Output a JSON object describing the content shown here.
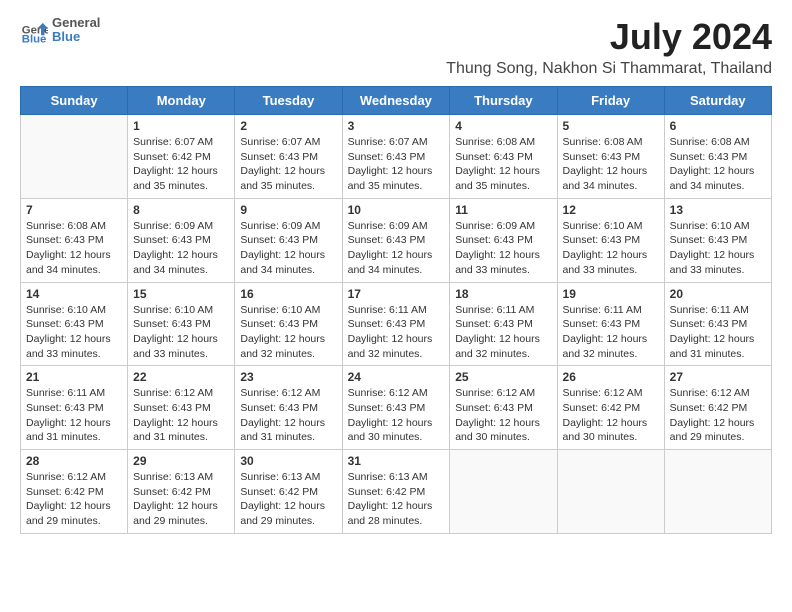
{
  "header": {
    "logo": {
      "line1": "General",
      "line2": "Blue"
    },
    "title": "July 2024",
    "subtitle": "Thung Song, Nakhon Si Thammarat, Thailand"
  },
  "calendar": {
    "weekdays": [
      "Sunday",
      "Monday",
      "Tuesday",
      "Wednesday",
      "Thursday",
      "Friday",
      "Saturday"
    ],
    "weeks": [
      [
        {
          "day": "",
          "sunrise": "",
          "sunset": "",
          "daylight": ""
        },
        {
          "day": "1",
          "sunrise": "Sunrise: 6:07 AM",
          "sunset": "Sunset: 6:42 PM",
          "daylight": "Daylight: 12 hours and 35 minutes."
        },
        {
          "day": "2",
          "sunrise": "Sunrise: 6:07 AM",
          "sunset": "Sunset: 6:43 PM",
          "daylight": "Daylight: 12 hours and 35 minutes."
        },
        {
          "day": "3",
          "sunrise": "Sunrise: 6:07 AM",
          "sunset": "Sunset: 6:43 PM",
          "daylight": "Daylight: 12 hours and 35 minutes."
        },
        {
          "day": "4",
          "sunrise": "Sunrise: 6:08 AM",
          "sunset": "Sunset: 6:43 PM",
          "daylight": "Daylight: 12 hours and 35 minutes."
        },
        {
          "day": "5",
          "sunrise": "Sunrise: 6:08 AM",
          "sunset": "Sunset: 6:43 PM",
          "daylight": "Daylight: 12 hours and 34 minutes."
        },
        {
          "day": "6",
          "sunrise": "Sunrise: 6:08 AM",
          "sunset": "Sunset: 6:43 PM",
          "daylight": "Daylight: 12 hours and 34 minutes."
        }
      ],
      [
        {
          "day": "7",
          "sunrise": "Sunrise: 6:08 AM",
          "sunset": "Sunset: 6:43 PM",
          "daylight": "Daylight: 12 hours and 34 minutes."
        },
        {
          "day": "8",
          "sunrise": "Sunrise: 6:09 AM",
          "sunset": "Sunset: 6:43 PM",
          "daylight": "Daylight: 12 hours and 34 minutes."
        },
        {
          "day": "9",
          "sunrise": "Sunrise: 6:09 AM",
          "sunset": "Sunset: 6:43 PM",
          "daylight": "Daylight: 12 hours and 34 minutes."
        },
        {
          "day": "10",
          "sunrise": "Sunrise: 6:09 AM",
          "sunset": "Sunset: 6:43 PM",
          "daylight": "Daylight: 12 hours and 34 minutes."
        },
        {
          "day": "11",
          "sunrise": "Sunrise: 6:09 AM",
          "sunset": "Sunset: 6:43 PM",
          "daylight": "Daylight: 12 hours and 33 minutes."
        },
        {
          "day": "12",
          "sunrise": "Sunrise: 6:10 AM",
          "sunset": "Sunset: 6:43 PM",
          "daylight": "Daylight: 12 hours and 33 minutes."
        },
        {
          "day": "13",
          "sunrise": "Sunrise: 6:10 AM",
          "sunset": "Sunset: 6:43 PM",
          "daylight": "Daylight: 12 hours and 33 minutes."
        }
      ],
      [
        {
          "day": "14",
          "sunrise": "Sunrise: 6:10 AM",
          "sunset": "Sunset: 6:43 PM",
          "daylight": "Daylight: 12 hours and 33 minutes."
        },
        {
          "day": "15",
          "sunrise": "Sunrise: 6:10 AM",
          "sunset": "Sunset: 6:43 PM",
          "daylight": "Daylight: 12 hours and 33 minutes."
        },
        {
          "day": "16",
          "sunrise": "Sunrise: 6:10 AM",
          "sunset": "Sunset: 6:43 PM",
          "daylight": "Daylight: 12 hours and 32 minutes."
        },
        {
          "day": "17",
          "sunrise": "Sunrise: 6:11 AM",
          "sunset": "Sunset: 6:43 PM",
          "daylight": "Daylight: 12 hours and 32 minutes."
        },
        {
          "day": "18",
          "sunrise": "Sunrise: 6:11 AM",
          "sunset": "Sunset: 6:43 PM",
          "daylight": "Daylight: 12 hours and 32 minutes."
        },
        {
          "day": "19",
          "sunrise": "Sunrise: 6:11 AM",
          "sunset": "Sunset: 6:43 PM",
          "daylight": "Daylight: 12 hours and 32 minutes."
        },
        {
          "day": "20",
          "sunrise": "Sunrise: 6:11 AM",
          "sunset": "Sunset: 6:43 PM",
          "daylight": "Daylight: 12 hours and 31 minutes."
        }
      ],
      [
        {
          "day": "21",
          "sunrise": "Sunrise: 6:11 AM",
          "sunset": "Sunset: 6:43 PM",
          "daylight": "Daylight: 12 hours and 31 minutes."
        },
        {
          "day": "22",
          "sunrise": "Sunrise: 6:12 AM",
          "sunset": "Sunset: 6:43 PM",
          "daylight": "Daylight: 12 hours and 31 minutes."
        },
        {
          "day": "23",
          "sunrise": "Sunrise: 6:12 AM",
          "sunset": "Sunset: 6:43 PM",
          "daylight": "Daylight: 12 hours and 31 minutes."
        },
        {
          "day": "24",
          "sunrise": "Sunrise: 6:12 AM",
          "sunset": "Sunset: 6:43 PM",
          "daylight": "Daylight: 12 hours and 30 minutes."
        },
        {
          "day": "25",
          "sunrise": "Sunrise: 6:12 AM",
          "sunset": "Sunset: 6:43 PM",
          "daylight": "Daylight: 12 hours and 30 minutes."
        },
        {
          "day": "26",
          "sunrise": "Sunrise: 6:12 AM",
          "sunset": "Sunset: 6:42 PM",
          "daylight": "Daylight: 12 hours and 30 minutes."
        },
        {
          "day": "27",
          "sunrise": "Sunrise: 6:12 AM",
          "sunset": "Sunset: 6:42 PM",
          "daylight": "Daylight: 12 hours and 29 minutes."
        }
      ],
      [
        {
          "day": "28",
          "sunrise": "Sunrise: 6:12 AM",
          "sunset": "Sunset: 6:42 PM",
          "daylight": "Daylight: 12 hours and 29 minutes."
        },
        {
          "day": "29",
          "sunrise": "Sunrise: 6:13 AM",
          "sunset": "Sunset: 6:42 PM",
          "daylight": "Daylight: 12 hours and 29 minutes."
        },
        {
          "day": "30",
          "sunrise": "Sunrise: 6:13 AM",
          "sunset": "Sunset: 6:42 PM",
          "daylight": "Daylight: 12 hours and 29 minutes."
        },
        {
          "day": "31",
          "sunrise": "Sunrise: 6:13 AM",
          "sunset": "Sunset: 6:42 PM",
          "daylight": "Daylight: 12 hours and 28 minutes."
        },
        {
          "day": "",
          "sunrise": "",
          "sunset": "",
          "daylight": ""
        },
        {
          "day": "",
          "sunrise": "",
          "sunset": "",
          "daylight": ""
        },
        {
          "day": "",
          "sunrise": "",
          "sunset": "",
          "daylight": ""
        }
      ]
    ]
  }
}
